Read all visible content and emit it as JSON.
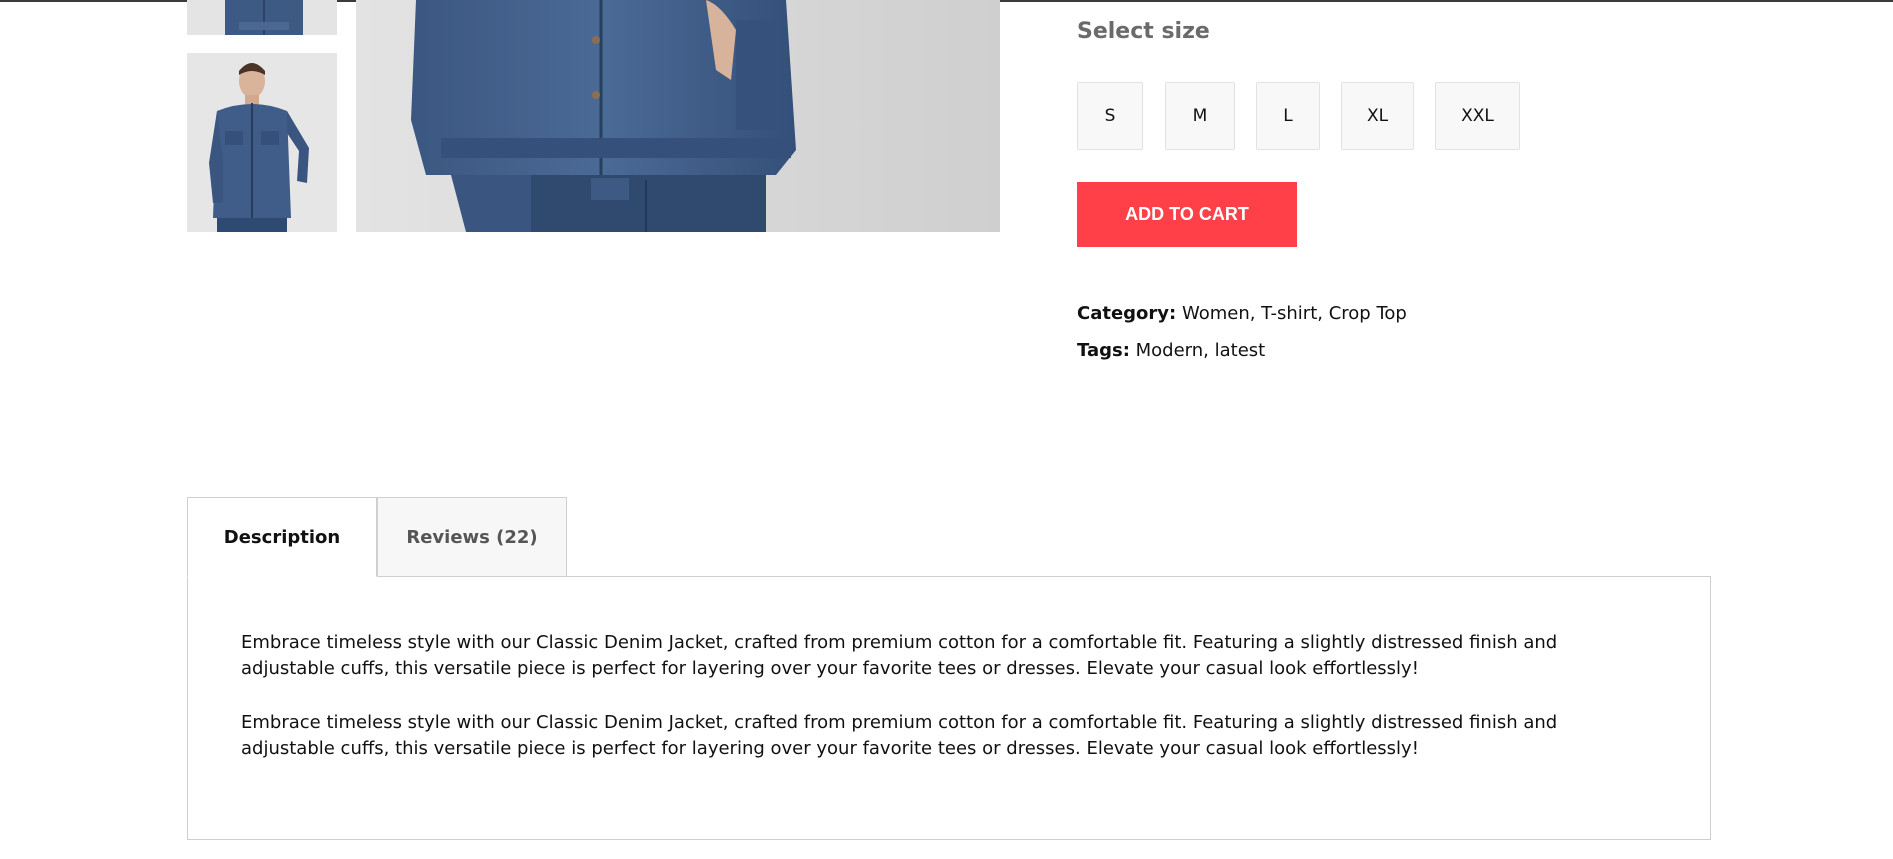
{
  "gallery": {
    "thumbnails": [
      "denim-jacket-thumb-front-crop",
      "denim-jacket-thumb-model-full"
    ],
    "main_image": "denim-jacket-main-closeup"
  },
  "product": {
    "select_size_label": "Select size",
    "sizes": [
      "S",
      "M",
      "L",
      "XL",
      "XXL"
    ],
    "add_to_cart_label": "ADD TO CART",
    "category_label": "Category:",
    "category_value": "Women, T-shirt, Crop Top",
    "tags_label": "Tags:",
    "tags_value": "Modern, latest"
  },
  "tabs": [
    {
      "label": "Description",
      "active": true
    },
    {
      "label": "Reviews (22)",
      "active": false
    }
  ],
  "description": {
    "paragraphs": [
      "Embrace timeless style with our Classic Denim Jacket, crafted from premium cotton for a comfortable fit. Featuring a slightly distressed finish and adjustable cuffs, this versatile piece is perfect for layering over your favorite tees or dresses. Elevate your casual look effortlessly!",
      "Embrace timeless style with our Classic Denim Jacket, crafted from premium cotton for a comfortable fit. Featuring a slightly distressed finish and adjustable cuffs, this versatile piece is perfect for layering over your favorite tees or dresses. Elevate your casual look effortlessly!"
    ]
  },
  "colors": {
    "accent": "#ff4049",
    "denim": "#3f5d88"
  }
}
